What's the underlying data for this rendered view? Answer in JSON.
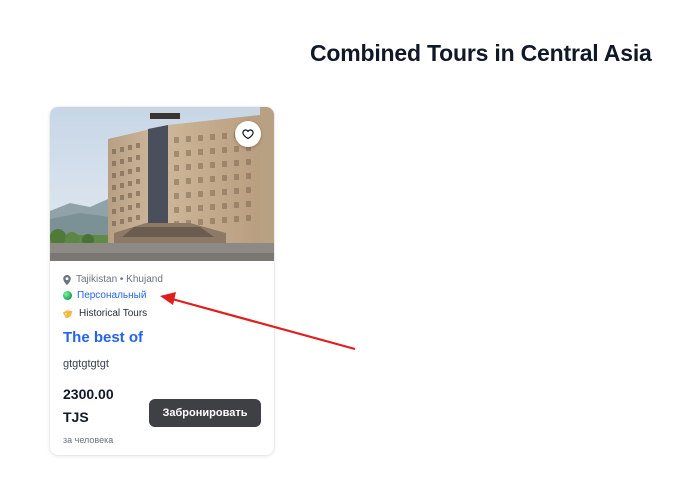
{
  "page": {
    "heading": "Combined Tours in Central Asia"
  },
  "tour_card": {
    "favorite_icon": "heart-outline-icon",
    "location": "Tajikistan • Khujand",
    "location_icon": "map-pin-icon",
    "type": "Персональный",
    "type_icon": "green-globe-dot-icon",
    "category": "Historical Tours",
    "category_icon": "tag-icon",
    "title": "The best of",
    "description": "gtgtgtgtgt",
    "price": "2300.00",
    "currency": "TJS",
    "price_note": "за человека",
    "book_label": "Забронировать"
  },
  "colors": {
    "title_link": "#2563eb",
    "book_button": "#3f3f46",
    "annotation_arrow": "#e11d1d"
  }
}
